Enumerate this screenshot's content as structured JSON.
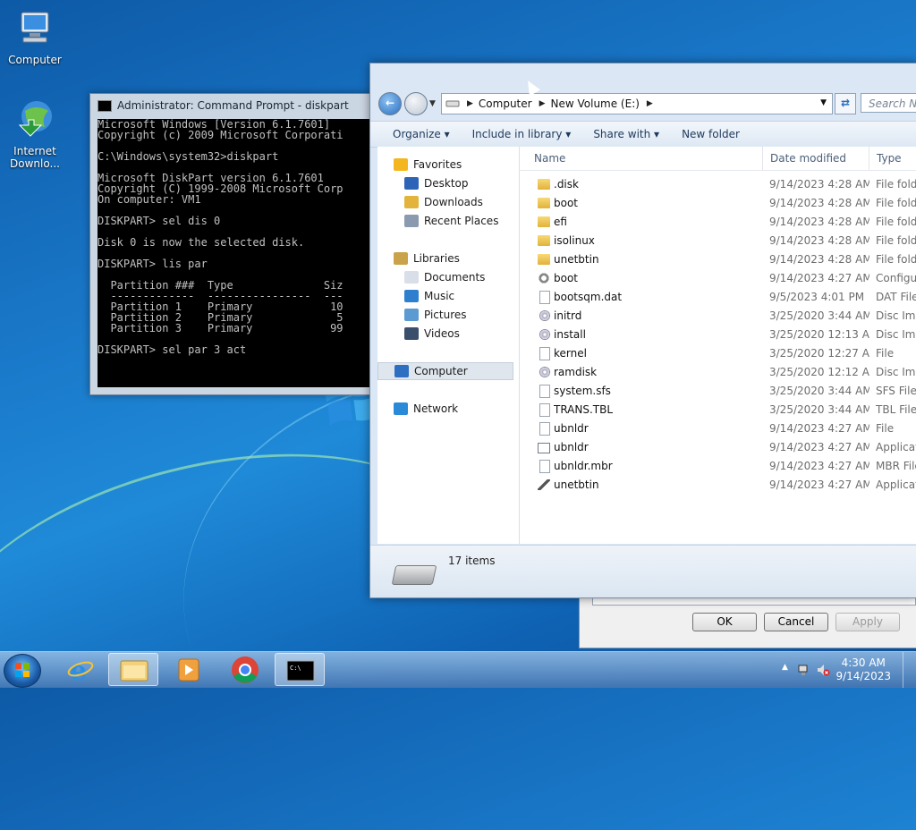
{
  "desktop": {
    "icons": [
      {
        "label": "Computer",
        "icon": "computer-icon"
      },
      {
        "label": "Internet Downlo...",
        "icon": "internet-download-manager-icon"
      }
    ]
  },
  "cmd": {
    "title": "Administrator: Command Prompt - diskpart",
    "lines": [
      "Microsoft Windows [Version 6.1.7601]",
      "Copyright (c) 2009 Microsoft Corporati",
      "",
      "C:\\Windows\\system32>diskpart",
      "",
      "Microsoft DiskPart version 6.1.7601",
      "Copyright (C) 1999-2008 Microsoft Corp",
      "On computer: VM1",
      "",
      "DISKPART> sel dis 0",
      "",
      "Disk 0 is now the selected disk.",
      "",
      "DISKPART> lis par",
      "",
      "  Partition ###  Type              Siz",
      "  -------------  ----------------  ---",
      "  Partition 1    Primary            10",
      "  Partition 2    Primary             5",
      "  Partition 3    Primary            99",
      "",
      "DISKPART> sel par 3 act"
    ]
  },
  "explorer": {
    "breadcrumb": [
      "Computer",
      "New Volume (E:)"
    ],
    "search_placeholder": "Search Ne",
    "toolbar": {
      "organize": "Organize",
      "include": "Include in library",
      "share": "Share with",
      "new_folder": "New folder"
    },
    "nav": {
      "favorites": "Favorites",
      "desktop": "Desktop",
      "downloads": "Downloads",
      "recent": "Recent Places",
      "libraries": "Libraries",
      "documents": "Documents",
      "music": "Music",
      "pictures": "Pictures",
      "videos": "Videos",
      "computer": "Computer",
      "network": "Network"
    },
    "columns": {
      "name": "Name",
      "date": "Date modified",
      "type": "Type"
    },
    "files": [
      {
        "name": ".disk",
        "date": "9/14/2023 4:28 AM",
        "type": "File folde",
        "icon": "folder"
      },
      {
        "name": "boot",
        "date": "9/14/2023 4:28 AM",
        "type": "File folde",
        "icon": "folder"
      },
      {
        "name": "efi",
        "date": "9/14/2023 4:28 AM",
        "type": "File folde",
        "icon": "folder"
      },
      {
        "name": "isolinux",
        "date": "9/14/2023 4:28 AM",
        "type": "File folde",
        "icon": "folder"
      },
      {
        "name": "unetbtin",
        "date": "9/14/2023 4:28 AM",
        "type": "File folde",
        "icon": "folder"
      },
      {
        "name": "boot",
        "date": "9/14/2023 4:27 AM",
        "type": "Configu",
        "icon": "gear"
      },
      {
        "name": "bootsqm.dat",
        "date": "9/5/2023 4:01 PM",
        "type": "DAT File",
        "icon": "file"
      },
      {
        "name": "initrd",
        "date": "3/25/2020 3:44 AM",
        "type": "Disc Ima",
        "icon": "disc"
      },
      {
        "name": "install",
        "date": "3/25/2020 12:13 AM",
        "type": "Disc Ima",
        "icon": "disc"
      },
      {
        "name": "kernel",
        "date": "3/25/2020 12:27 AM",
        "type": "File",
        "icon": "file"
      },
      {
        "name": "ramdisk",
        "date": "3/25/2020 12:12 AM",
        "type": "Disc Ima",
        "icon": "disc"
      },
      {
        "name": "system.sfs",
        "date": "3/25/2020 3:44 AM",
        "type": "SFS File",
        "icon": "file"
      },
      {
        "name": "TRANS.TBL",
        "date": "3/25/2020 3:44 AM",
        "type": "TBL File",
        "icon": "file"
      },
      {
        "name": "ubnldr",
        "date": "9/14/2023 4:27 AM",
        "type": "File",
        "icon": "file"
      },
      {
        "name": "ubnldr",
        "date": "9/14/2023 4:27 AM",
        "type": "Applicat",
        "icon": "app"
      },
      {
        "name": "ubnldr.mbr",
        "date": "9/14/2023 4:27 AM",
        "type": "MBR File",
        "icon": "file"
      },
      {
        "name": "unetbtin",
        "date": "9/14/2023 4:27 AM",
        "type": "Applicat",
        "icon": "wrench"
      }
    ],
    "status": "17 items"
  },
  "dialog": {
    "ok": "OK",
    "cancel": "Cancel",
    "apply": "Apply"
  },
  "taskbar": {
    "apps": [
      "internet-explorer-icon",
      "windows-explorer-icon",
      "media-player-icon",
      "chrome-icon",
      "command-prompt-icon"
    ],
    "time": "4:30 AM",
    "date": "9/14/2023"
  }
}
